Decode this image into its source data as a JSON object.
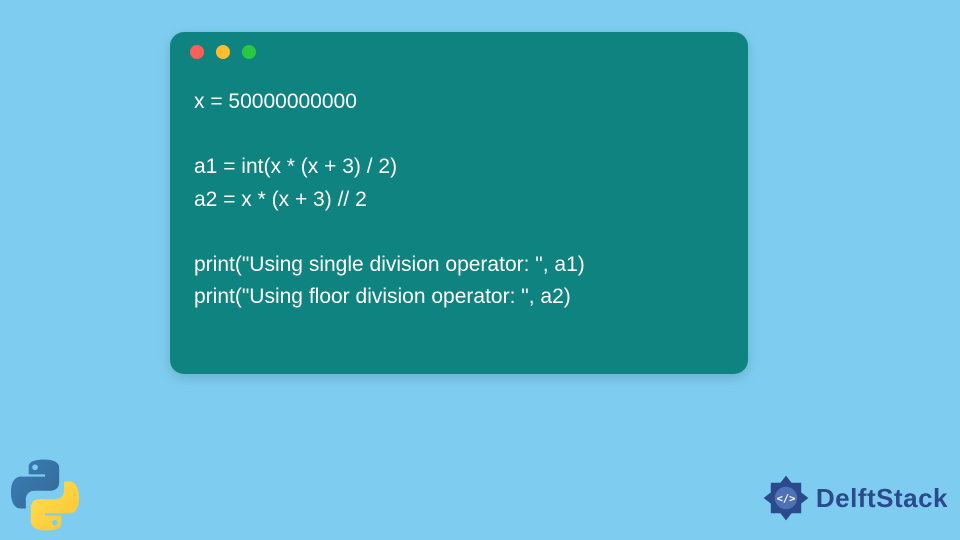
{
  "window": {
    "dots": [
      "red",
      "yellow",
      "green"
    ]
  },
  "code": {
    "lines": [
      "x = 50000000000",
      "",
      "a1 = int(x * (x + 3) / 2)",
      "a2 = x * (x + 3) // 2",
      "",
      "print(\"Using single division operator: \", a1)",
      "print(\"Using floor division operator: \", a2)"
    ]
  },
  "branding": {
    "site_name": "DelftStack",
    "language_icon": "python"
  },
  "colors": {
    "page_bg": "#7ecdf0",
    "window_bg": "#0f837f",
    "code_text": "#ffffff",
    "brand_text": "#2b4a8b"
  }
}
